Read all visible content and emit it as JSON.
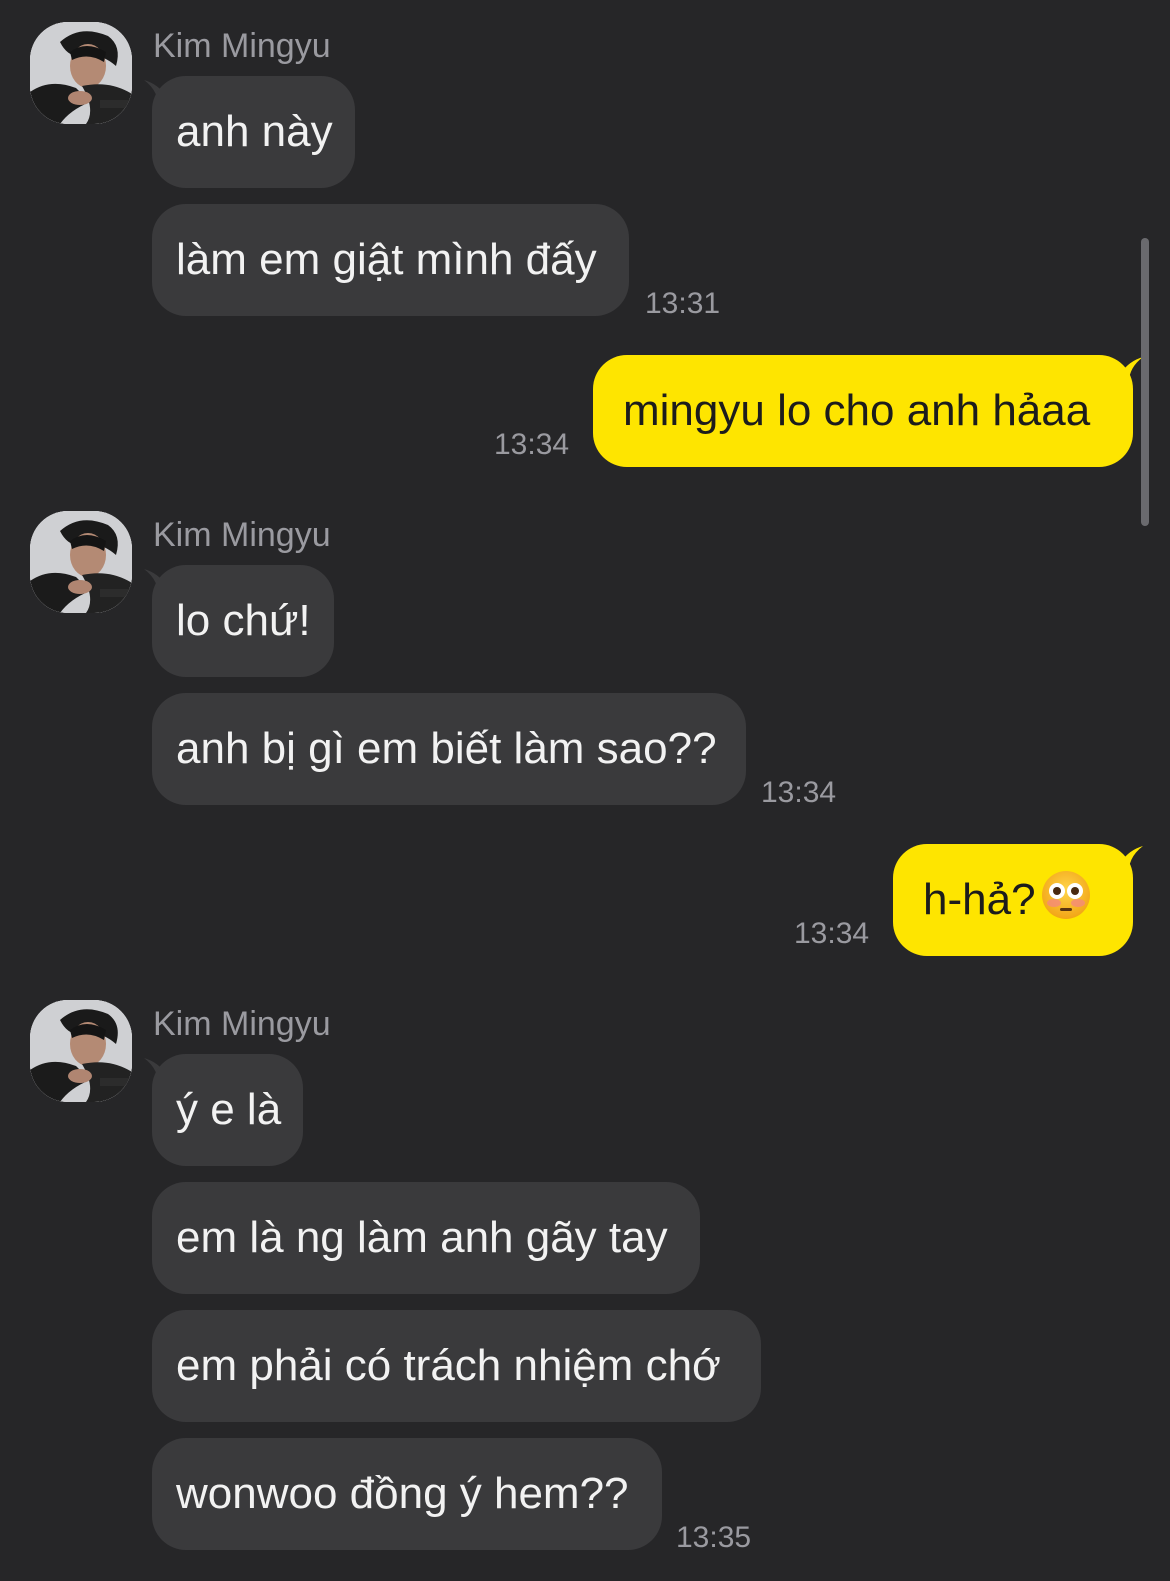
{
  "theme": {
    "background": "#262628",
    "incoming_bubble": "#3a3a3c",
    "outgoing_bubble": "#fee500",
    "meta_text": "#9a9aa0"
  },
  "chat": {
    "groups": [
      {
        "sender": "Kim Mingyu",
        "avatar": "profile-photo",
        "messages": [
          "anh này",
          "làm em giật mình đấy"
        ],
        "time": "13:31"
      },
      {
        "direction": "outgoing",
        "messages": [
          "mingyu lo cho anh hảaa"
        ],
        "time": "13:34"
      },
      {
        "sender": "Kim Mingyu",
        "avatar": "profile-photo",
        "messages": [
          "lo chứ!",
          "anh bị gì em biết làm sao??"
        ],
        "time": "13:34"
      },
      {
        "direction": "outgoing",
        "messages": [
          "h-hả?"
        ],
        "emoji": "flushed-face-emoji",
        "time": "13:34"
      },
      {
        "sender": "Kim Mingyu",
        "avatar": "profile-photo",
        "messages": [
          "ý e là",
          "em là ng làm anh gãy tay",
          "em phải có trách nhiệm chớ",
          "wonwoo đồng ý hem??"
        ],
        "time": "13:35"
      }
    ]
  }
}
